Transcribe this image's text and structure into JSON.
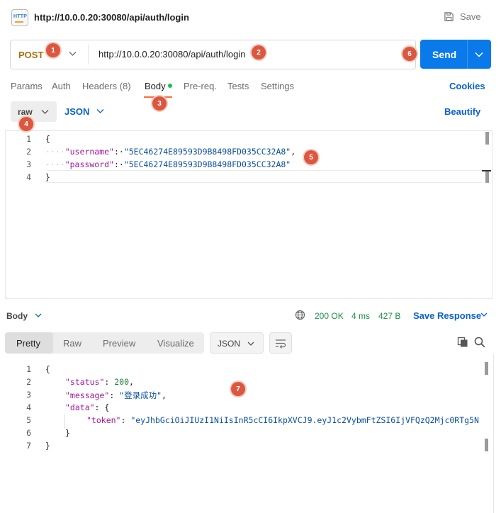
{
  "title_bar": {
    "icon_label": "HTTP",
    "url": "http://10.0.0.20:30080/api/auth/login",
    "save_label": "Save"
  },
  "request": {
    "method": "POST",
    "url": "http://10.0.0.20:30080/api/auth/login",
    "send_label": "Send"
  },
  "tabs": [
    {
      "label": "Params"
    },
    {
      "label": "Auth"
    },
    {
      "label": "Headers (8)"
    },
    {
      "label": "Body"
    },
    {
      "label": "Pre-req."
    },
    {
      "label": "Tests"
    },
    {
      "label": "Settings"
    }
  ],
  "cookies_label": "Cookies",
  "body_options": {
    "mode": "raw",
    "format": "JSON",
    "beautify_label": "Beautify"
  },
  "request_body": {
    "line_numbers": [
      "1",
      "2",
      "3",
      "4"
    ],
    "open_brace": "{",
    "close_brace": "}",
    "username_key": "\"username\"",
    "username_value": "\"5EC46274E89593D9B8498FD035CC32A8\"",
    "password_key": "\"password\"",
    "password_value": "\"5EC46274E89593D9B8498FD035CC32A8\""
  },
  "response_bar": {
    "body_label": "Body",
    "status": "200 OK",
    "time": "4 ms",
    "size": "427 B",
    "save_response_label": "Save Response"
  },
  "response_views": [
    "Pretty",
    "Raw",
    "Preview",
    "Visualize"
  ],
  "response_format": "JSON",
  "response_body": {
    "line_numbers": [
      "1",
      "2",
      "3",
      "4",
      "5",
      "6",
      "7"
    ],
    "status_key": "\"status\"",
    "status_value": "200",
    "message_key": "\"message\"",
    "message_value": "\"登录成功\"",
    "data_key": "\"data\"",
    "token_key": "\"token\"",
    "token_value": "\"eyJhbGciOiJIUzI1NiIsInR5cCI6IkpXVCJ9.eyJ1c2VybmFtZSI6IjVFQzQ2Mjc0RTg5N"
  },
  "markers": [
    "1",
    "2",
    "3",
    "4",
    "5",
    "6",
    "7"
  ],
  "colors": {
    "accent": "#0a7aeb",
    "method": "#a8700a",
    "status_ok": "#1a8f44",
    "marker": "#db5740",
    "tab_underline": "#ff6c37"
  }
}
